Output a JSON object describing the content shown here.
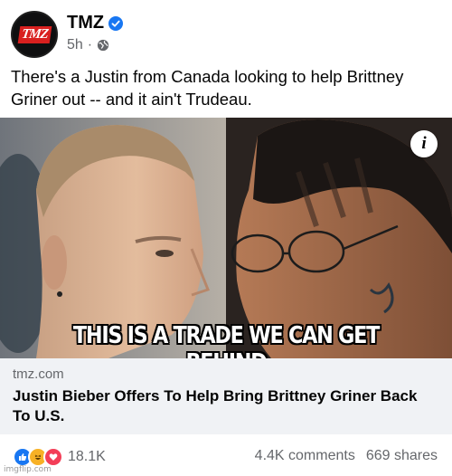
{
  "post": {
    "page_name": "TMZ",
    "avatar_text": "TMZ",
    "time": "5h",
    "separator": "·",
    "body": "There's a Justin from Canada looking to help Brittney Griner out -- and it ain't Trudeau."
  },
  "media": {
    "caption": "THIS IS A TRADE WE CAN GET BEHIND",
    "info_label": "i"
  },
  "link": {
    "domain": "tmz.com",
    "title": "Justin Bieber Offers To Help Bring Brittney Griner Back To U.S."
  },
  "engagement": {
    "reaction_icons": [
      "like-icon",
      "haha-icon",
      "love-icon"
    ],
    "reaction_count": "18.1K",
    "comments": "4.4K comments",
    "shares": "669 shares"
  },
  "watermark": "imgflip.com",
  "colors": {
    "verified": "#1877f2",
    "like": "#1877f2",
    "haha": "#f7b125",
    "love": "#f33e58",
    "tmz_red": "#d9201f",
    "link_bg": "#f0f2f5"
  }
}
